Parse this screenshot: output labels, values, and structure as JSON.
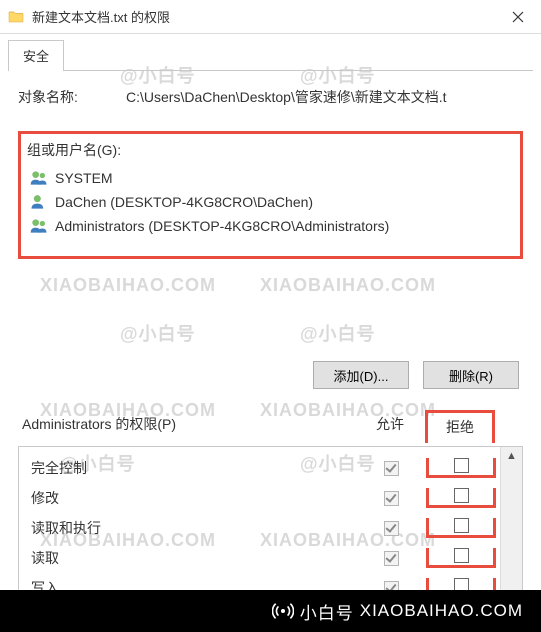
{
  "window": {
    "title": "新建文本文档.txt 的权限"
  },
  "tabs": {
    "security": "安全"
  },
  "object": {
    "label": "对象名称:",
    "path": "C:\\Users\\DaChen\\Desktop\\管家速修\\新建文本文档.t"
  },
  "groups": {
    "label": "组或用户名(G):",
    "items": [
      {
        "name": "SYSTEM",
        "icon": "group"
      },
      {
        "name": "DaChen (DESKTOP-4KG8CRO\\DaChen)",
        "icon": "user"
      },
      {
        "name": "Administrators (DESKTOP-4KG8CRO\\Administrators)",
        "icon": "group"
      }
    ]
  },
  "buttons": {
    "add": "添加(D)...",
    "remove": "删除(R)"
  },
  "permissions": {
    "header_label": "Administrators 的权限(P)",
    "allow_label": "允许",
    "deny_label": "拒绝",
    "rows": [
      {
        "label": "完全控制",
        "allow": true,
        "allow_disabled": true,
        "deny": false
      },
      {
        "label": "修改",
        "allow": true,
        "allow_disabled": true,
        "deny": false
      },
      {
        "label": "读取和执行",
        "allow": true,
        "allow_disabled": true,
        "deny": false
      },
      {
        "label": "读取",
        "allow": true,
        "allow_disabled": true,
        "deny": false
      },
      {
        "label": "写入",
        "allow": true,
        "allow_disabled": true,
        "deny": false
      }
    ]
  },
  "footer": {
    "brand": "小白号",
    "url": "XIAOBAIHAO.COM"
  },
  "watermark_samples": [
    "@小白号",
    "XIAOBAIHAO.COM"
  ]
}
